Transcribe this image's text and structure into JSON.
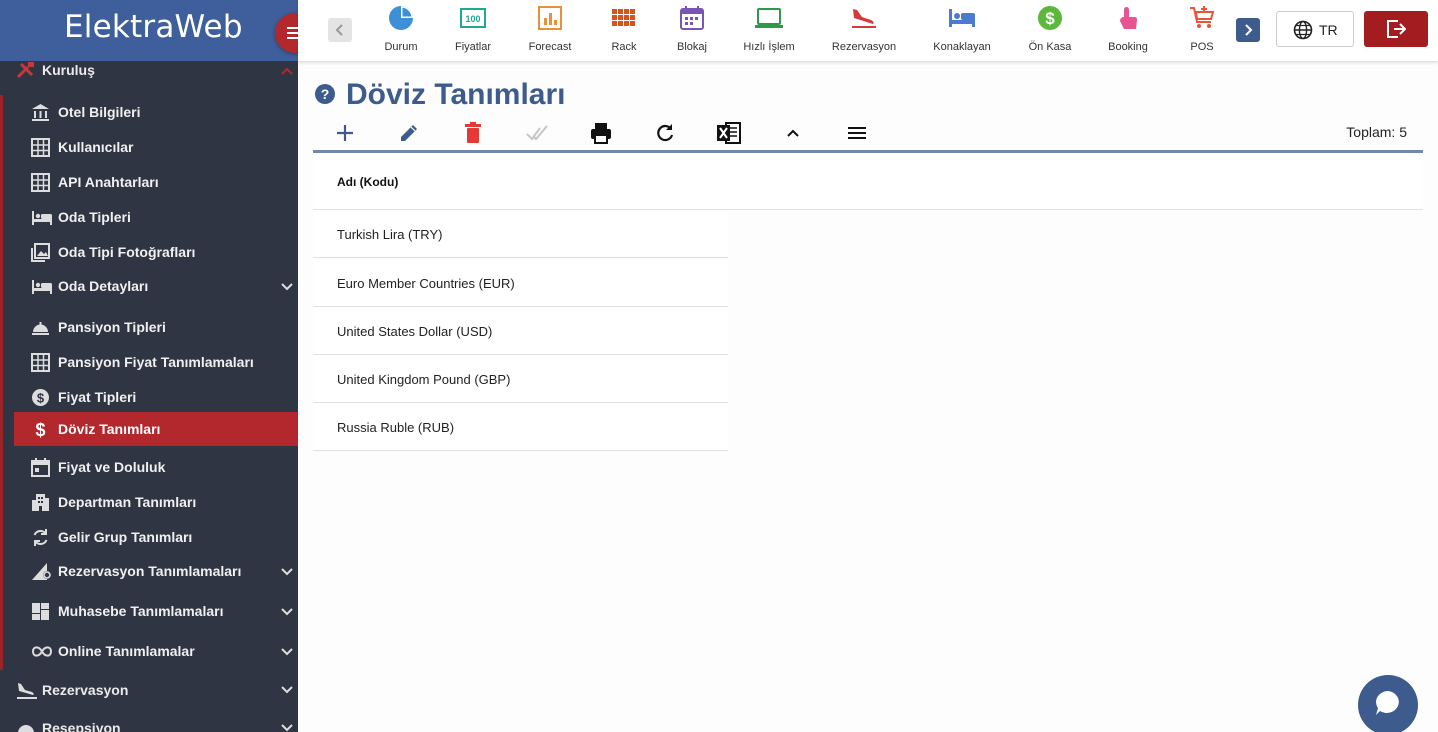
{
  "app": {
    "logo": "ElektraWeb",
    "language": "TR"
  },
  "topnav": {
    "items": [
      {
        "label": "Durum",
        "icon": "pie-chart-icon",
        "color": "#3d8fd6"
      },
      {
        "label": "Fiyatlar",
        "icon": "price-tag-icon",
        "color": "#1fa894"
      },
      {
        "label": "Forecast",
        "icon": "bar-chart-icon",
        "color": "#e8913a"
      },
      {
        "label": "Rack",
        "icon": "grid-icon",
        "color": "#d9531e"
      },
      {
        "label": "Blokaj",
        "icon": "calendar-icon",
        "color": "#7a55b3"
      },
      {
        "label": "Hızlı İşlem",
        "icon": "laptop-icon",
        "color": "#2e9a48"
      },
      {
        "label": "Rezervasyon",
        "icon": "plane-landing-icon",
        "color": "#d6393b"
      },
      {
        "label": "Konaklayan",
        "icon": "bed-icon",
        "color": "#4a7bd0"
      },
      {
        "label": "Ön Kasa",
        "icon": "dollar-coin-icon",
        "color": "#5cb83a"
      },
      {
        "label": "Booking",
        "icon": "touch-icon",
        "color": "#e8548f"
      },
      {
        "label": "POS",
        "icon": "cart-icon",
        "color": "#e8553a"
      }
    ]
  },
  "sidebar": {
    "sections": [
      {
        "label": "Kuruluş",
        "icon": "tools-icon",
        "expanded": true
      },
      {
        "label": "Rezervasyon",
        "icon": "plane-landing-icon"
      },
      {
        "label": "Resepsiyon",
        "icon": "bell-icon"
      }
    ],
    "items": [
      {
        "label": "Otel Bilgileri",
        "icon": "bank-icon"
      },
      {
        "label": "Kullanıcılar",
        "icon": "table-icon"
      },
      {
        "label": "API Anahtarları",
        "icon": "table-icon"
      },
      {
        "label": "Oda Tipleri",
        "icon": "bed-icon"
      },
      {
        "label": "Oda Tipi Fotoğrafları",
        "icon": "image-icon"
      },
      {
        "label": "Oda Detayları",
        "icon": "bed-icon",
        "has_children": true
      },
      {
        "label": "Pansiyon Tipleri",
        "icon": "room-service-icon"
      },
      {
        "label": "Pansiyon Fiyat Tanımlamaları",
        "icon": "table-icon"
      },
      {
        "label": "Fiyat Tipleri",
        "icon": "dollar-circle-icon"
      },
      {
        "label": "Döviz Tanımları",
        "icon": "dollar-icon",
        "active": true
      },
      {
        "label": "Fiyat ve Doluluk",
        "icon": "calendar-icon"
      },
      {
        "label": "Departman Tanımları",
        "icon": "building-icon"
      },
      {
        "label": "Gelir Grup Tanımları",
        "icon": "sync-icon"
      },
      {
        "label": "Rezervasyon Tanımlamaları",
        "icon": "settings-chart-icon",
        "has_children": true
      },
      {
        "label": "Muhasebe Tanımlamaları",
        "icon": "dashboard-icon",
        "has_children": true
      },
      {
        "label": "Online Tanımlamalar",
        "icon": "infinity-icon",
        "has_children": true
      }
    ]
  },
  "page": {
    "title": "Döviz Tanımları",
    "total_label": "Toplam: 5",
    "toolbar": [
      "add-icon",
      "edit-icon",
      "delete-icon",
      "check-icon",
      "print-icon",
      "refresh-icon",
      "excel-icon",
      "collapse-icon",
      "menu-icon"
    ]
  },
  "grid": {
    "columns": [
      "Adı (Kodu)"
    ],
    "rows": [
      "Turkish Lira (TRY)",
      "Euro Member Countries (EUR)",
      "United States Dollar (USD)",
      "United Kingdom Pound (GBP)",
      "Russia Ruble (RUB)"
    ]
  },
  "colors": {
    "brand": "#3f5f9c",
    "accent": "#b3282d",
    "sidebar_bg": "#2f3542",
    "title": "#3d5b8c"
  }
}
